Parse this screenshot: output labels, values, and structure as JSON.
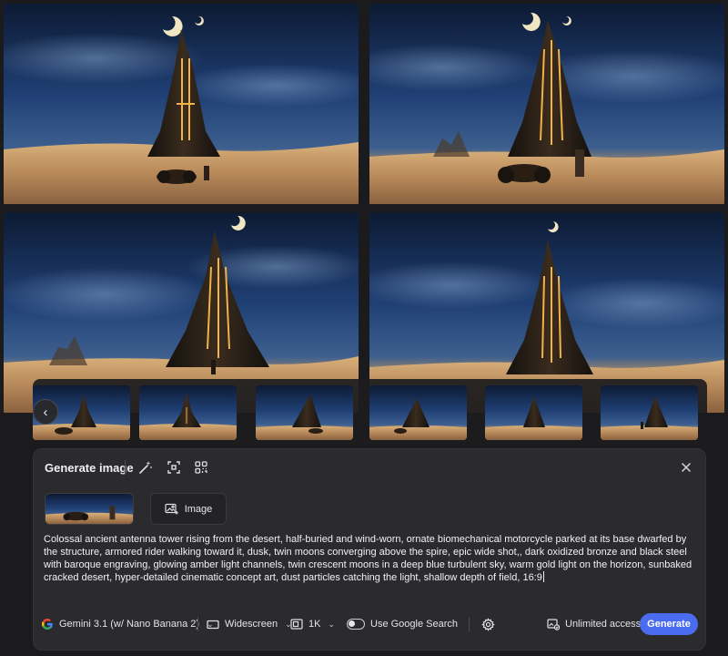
{
  "panel": {
    "title": "Generate image",
    "image_button_label": "Image",
    "prompt": "Colossal ancient antenna tower rising from the desert, half-buried and wind-worn, ornate biomechanical motorcycle parked at its base dwarfed by the structure, armored rider walking toward it, dusk, twin moons converging above the spire, epic wide shot,, dark oxidized bronze and black steel with baroque engraving, glowing amber light channels, twin crescent moons in a deep blue turbulent sky, warm gold light on the horizon, sunbaked cracked desert, hyper-detailed cinematic concept art, dust particles catching the light, shallow depth of field, 16:9"
  },
  "toolbar": {
    "model_label": "Gemini 3.1 (w/ Nano Banana 2)",
    "aspect_label": "Widescreen",
    "resolution_label": "1K",
    "google_search_label": "Use Google Search",
    "access_label": "Unlimited access",
    "generate_label": "Generate"
  },
  "icons": {
    "header": [
      "magic-wand-icon",
      "crop-select-icon",
      "qr-scan-icon",
      "close-icon"
    ],
    "toolbar": [
      "google-g-icon",
      "widescreen-icon",
      "image-size-icon",
      "toggle",
      "settings-icon",
      "access-icon"
    ]
  },
  "colors": {
    "accent": "#4b6cf0",
    "panel_bg": "#2b2b2e",
    "page_bg": "#1b1b1d",
    "sky": "#1d3a6e",
    "sand": "#c9a06a",
    "glow": "#f2b24a"
  }
}
